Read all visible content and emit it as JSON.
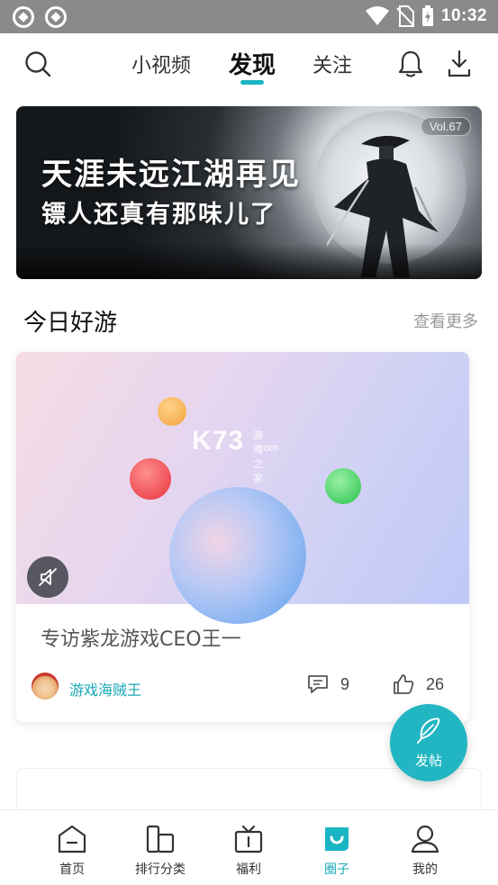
{
  "status_bar": {
    "time": "10:32"
  },
  "top_nav": {
    "tabs": [
      {
        "label": "小视频"
      },
      {
        "label": "发现"
      },
      {
        "label": "关注"
      }
    ]
  },
  "banner": {
    "volume": "Vol.67",
    "headline": "天涯未远江湖再见",
    "subline": "镖人还真有那味儿了"
  },
  "section": {
    "title": "今日好游",
    "more": "查看更多"
  },
  "post": {
    "watermark_brand": "K73",
    "watermark_sub": "游戏之家",
    "watermark_domain": ".com",
    "title": "专访紫龙游戏CEO王一",
    "author": "游戏海贼王",
    "comments": "9",
    "likes": "26"
  },
  "fab": {
    "label": "发帖"
  },
  "bottom_nav": {
    "items": [
      {
        "label": "首页"
      },
      {
        "label": "排行分类"
      },
      {
        "label": "福利"
      },
      {
        "label": "圈子"
      },
      {
        "label": "我的"
      }
    ]
  },
  "colors": {
    "accent": "#19b5c3"
  }
}
